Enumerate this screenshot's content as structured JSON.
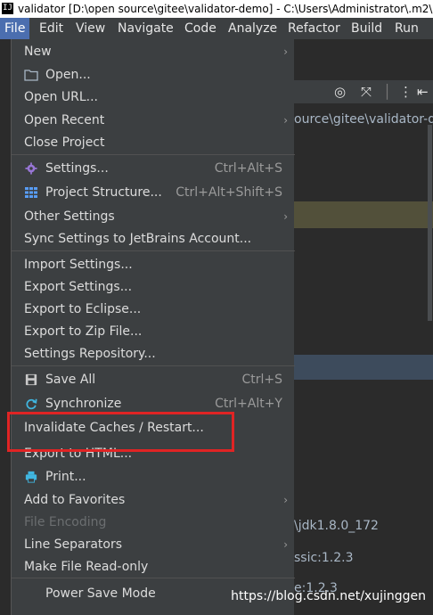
{
  "window": {
    "title": "validator [D:\\open source\\gitee\\validator-demo] - C:\\Users\\Administrator\\.m2\\se",
    "app_icon_glyph": "IJ"
  },
  "menubar": [
    "File",
    "Edit",
    "View",
    "Navigate",
    "Code",
    "Analyze",
    "Refactor",
    "Build",
    "Run"
  ],
  "file_menu": {
    "new": "New",
    "open": "Open...",
    "open_url": "Open URL...",
    "open_recent": "Open Recent",
    "close_project": "Close Project",
    "settings": "Settings...",
    "settings_shortcut": "Ctrl+Alt+S",
    "project_structure": "Project Structure...",
    "project_structure_shortcut": "Ctrl+Alt+Shift+S",
    "other_settings": "Other Settings",
    "sync_settings": "Sync Settings to JetBrains Account...",
    "import_settings": "Import Settings...",
    "export_settings": "Export Settings...",
    "export_eclipse": "Export to Eclipse...",
    "export_zip": "Export to Zip File...",
    "settings_repository": "Settings Repository...",
    "save_all": "Save All",
    "save_all_shortcut": "Ctrl+S",
    "synchronize": "Synchronize",
    "synchronize_shortcut": "Ctrl+Alt+Y",
    "invalidate_caches": "Invalidate Caches / Restart...",
    "export_html": "Export to HTML...",
    "print": "Print...",
    "add_favorites": "Add to Favorites",
    "file_encoding": "File Encoding",
    "line_separators": "Line Separators",
    "make_read_only": "Make File Read-only",
    "power_save": "Power Save Mode"
  },
  "background": {
    "path": "ource\\gitee\\validator-d",
    "jdk": "\\jdk1.8.0_172",
    "dep1": "ssic:1.2.3",
    "dep2": "e:1.2.3"
  },
  "watermark": "https://blog.csdn.net/xujinggen",
  "colors": {
    "menu_bg": "#3c3f41",
    "active_menu": "#4b6eaf",
    "annotation_red": "#e02424"
  }
}
